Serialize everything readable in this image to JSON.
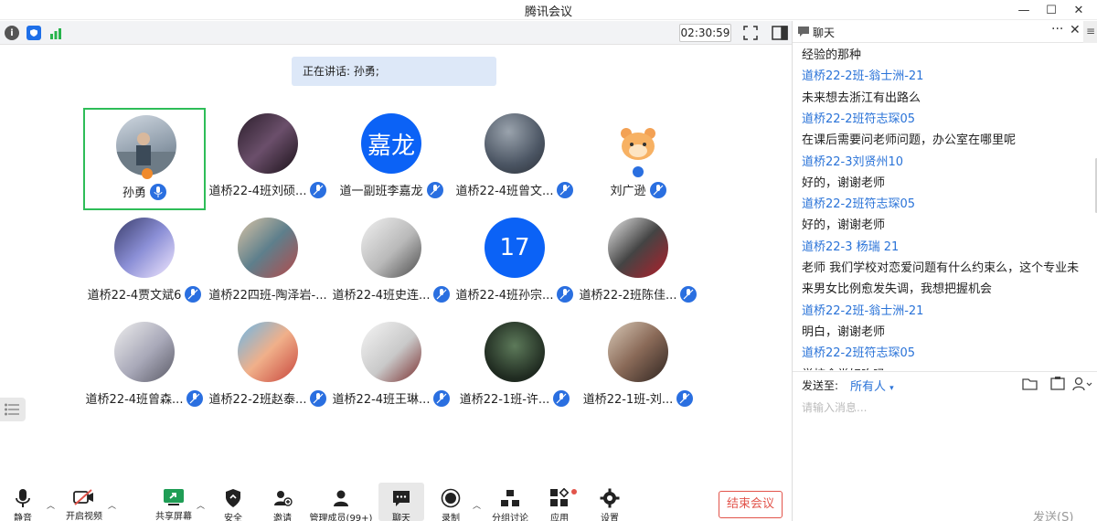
{
  "window": {
    "title": "腾讯会议",
    "minimize": "—",
    "maximize": "☐",
    "close": "✕"
  },
  "meeting": {
    "timer": "02:30:59",
    "speaking_text": "正在讲话: 孙勇;"
  },
  "participants": [
    {
      "name": "孙勇",
      "avatar": "photo-man",
      "active": true
    },
    {
      "name": "道桥22-4班刘硕...",
      "avatar": "dark-anime"
    },
    {
      "name": "道一副班李嘉龙",
      "avatar_text": "嘉龙"
    },
    {
      "name": "道桥22-4班曾文...",
      "avatar": "night-sky"
    },
    {
      "name": "刘广逊",
      "avatar": "bear-cartoon"
    },
    {
      "name": "道桥22-4贾文斌6",
      "avatar": "anime-girl"
    },
    {
      "name": "道桥22四班-陶泽岩-...",
      "avatar": "anime-girl-2"
    },
    {
      "name": "道桥22-4班史连...",
      "avatar": "anime-boy"
    },
    {
      "name": "道桥22-4班孙宗...",
      "avatar_text": "17"
    },
    {
      "name": "道桥22-2班陈佳...",
      "avatar": "anime-dark"
    },
    {
      "name": "道桥22-4班曾森...",
      "avatar": "anime-boy-2"
    },
    {
      "name": "道桥22-2班赵泰...",
      "avatar": "anime-red"
    },
    {
      "name": "道桥22-4班王琳...",
      "avatar": "anime-white"
    },
    {
      "name": "道桥22-1班-许...",
      "avatar": "forest"
    },
    {
      "name": "道桥22-1班-刘...",
      "avatar": "girl-photo"
    }
  ],
  "toolbar": {
    "mute": "静音",
    "video": "开启视频",
    "share": "共享屏幕",
    "security": "安全",
    "invite": "邀请",
    "members": "管理成员(99+)",
    "chat": "聊天",
    "record": "录制",
    "breakout": "分组讨论",
    "apps": "应用",
    "settings": "设置",
    "end": "结束会议"
  },
  "chat": {
    "title": "聊天",
    "messages": [
      {
        "kind": "text",
        "value": "经验的那种"
      },
      {
        "kind": "sender",
        "value": "道桥22-2班-翁士洲-21"
      },
      {
        "kind": "text",
        "value": "未来想去浙江有出路么"
      },
      {
        "kind": "sender",
        "value": "道桥22-2班符志琛05"
      },
      {
        "kind": "text",
        "value": "在课后需要问老师问题，办公室在哪里呢"
      },
      {
        "kind": "sender",
        "value": "道桥22-3刘贤州10"
      },
      {
        "kind": "text",
        "value": "好的，谢谢老师"
      },
      {
        "kind": "sender",
        "value": "道桥22-2班符志琛05"
      },
      {
        "kind": "text",
        "value": "好的，谢谢老师"
      },
      {
        "kind": "sender",
        "value": "道桥22-3  杨瑞  21"
      },
      {
        "kind": "text",
        "value": "老师   我们学校对恋爱问题有什么约束么，这个专业未"
      },
      {
        "kind": "text",
        "value": "来男女比例愈发失调，我想把握机会"
      },
      {
        "kind": "sender",
        "value": "道桥22-2班-翁士洲-21"
      },
      {
        "kind": "text",
        "value": "明白，谢谢老师"
      },
      {
        "kind": "sender",
        "value": "道桥22-2班符志琛05"
      },
      {
        "kind": "text",
        "value": "学校食堂好吃吗"
      }
    ],
    "send_to_label": "发送至:",
    "send_to_value": "所有人",
    "input_placeholder": "请输入消息...",
    "send_button": "发送(S)"
  },
  "colors": {
    "accent": "#2a73d8",
    "active_border": "#2ebd58",
    "end_red": "#e2544b"
  }
}
